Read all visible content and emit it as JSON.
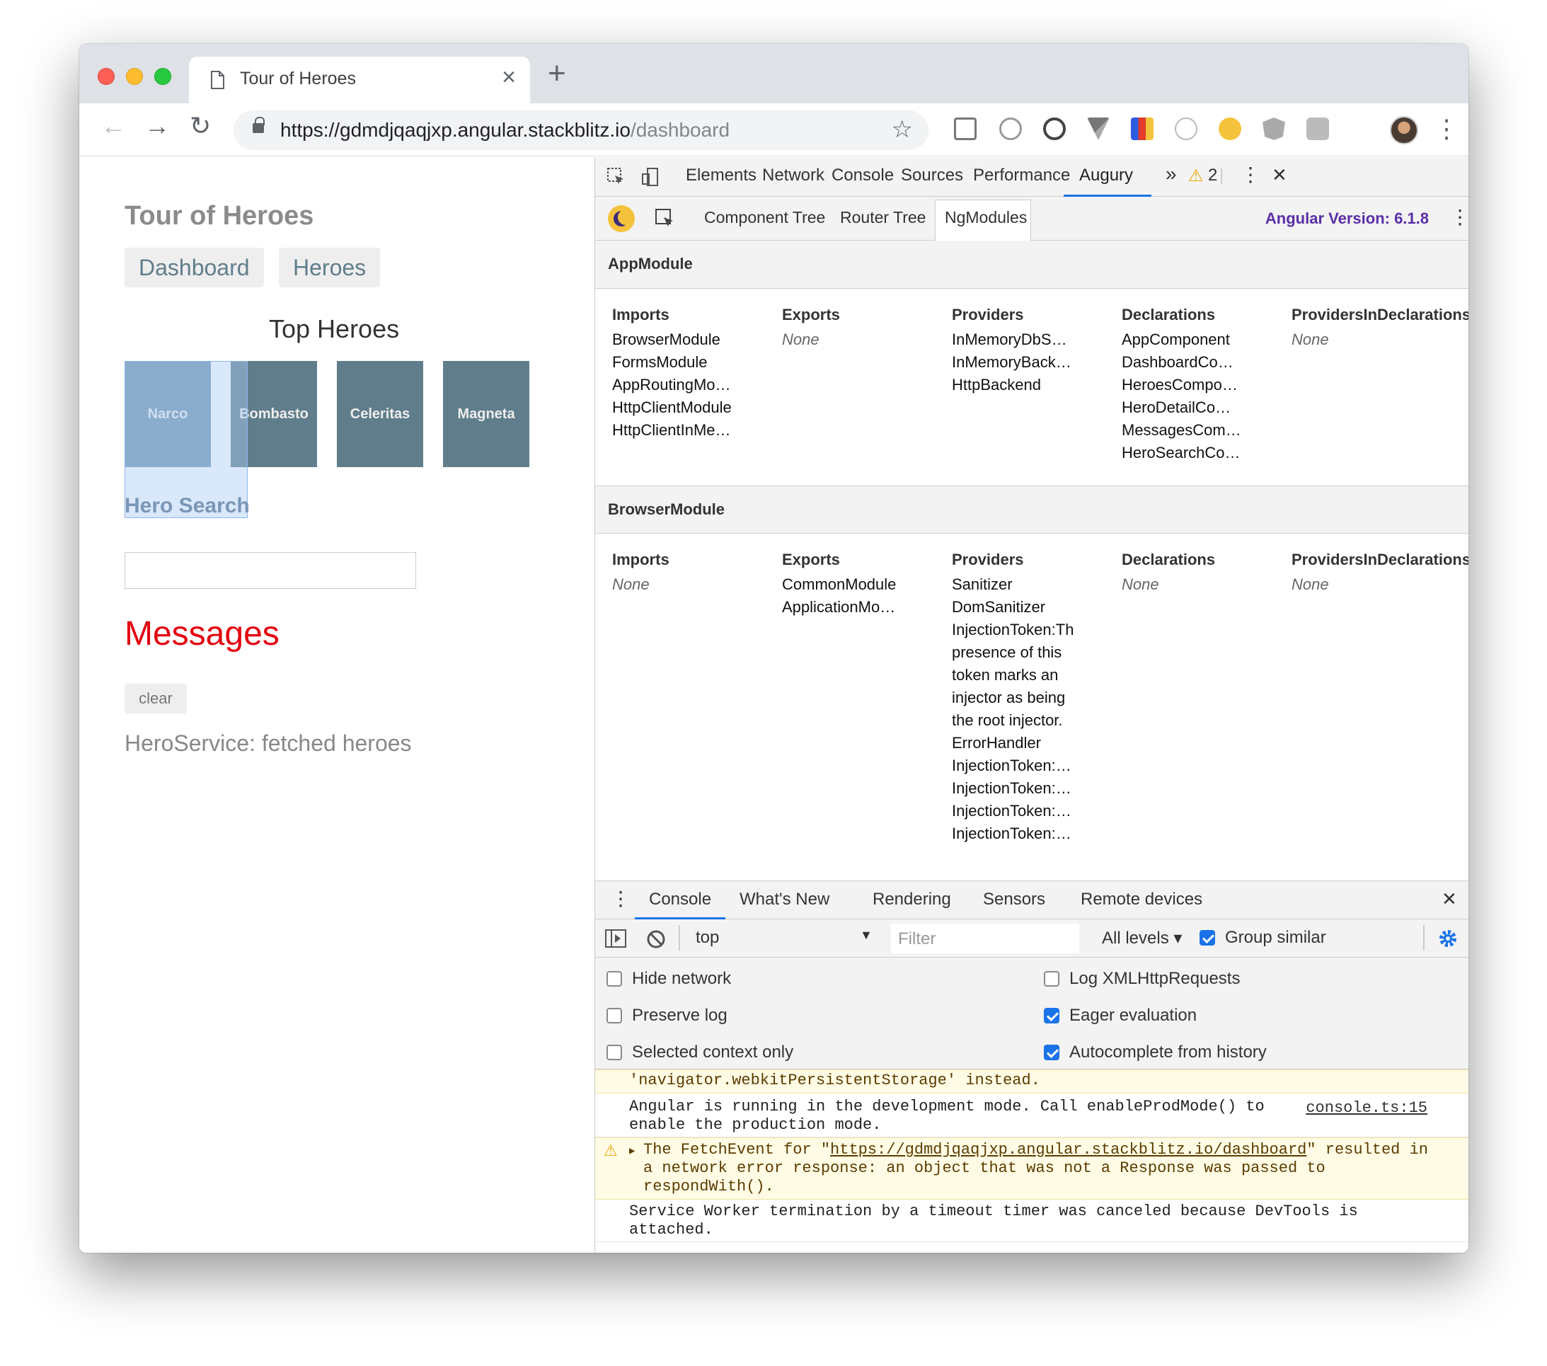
{
  "browser": {
    "tab_title": "Tour of Heroes",
    "tab_close": "×",
    "new_tab": "+",
    "url_host": "https://gdmdjqaqjxp.angular.stackblitz.io",
    "url_path": "/dashboard",
    "back": "←",
    "forward": "→",
    "reload": "↻",
    "star": "☆",
    "menu": "⋮"
  },
  "app": {
    "title": "Tour of Heroes",
    "nav": [
      "Dashboard",
      "Heroes"
    ],
    "top_heroes": "Top Heroes",
    "heroes": [
      "Narco",
      "Bombasto",
      "Celeritas",
      "Magneta"
    ],
    "hero_search": "Hero Search",
    "messages_title": "Messages",
    "clear_label": "clear",
    "message": "HeroService: fetched heroes"
  },
  "devtools": {
    "tabs": [
      "Elements",
      "Network",
      "Console",
      "Sources",
      "Performance",
      "Augury"
    ],
    "active_tab": "Augury",
    "more": "»",
    "warnings": "2",
    "menu": "⋮",
    "close": "✕",
    "augury": {
      "tabs": [
        "Component Tree",
        "Router Tree",
        "NgModules"
      ],
      "active": "NgModules",
      "version": "Angular Version: 6.1.8",
      "menu": "⋮"
    },
    "modules": [
      {
        "name": "AppModule",
        "headers": [
          "Imports",
          "Exports",
          "Providers",
          "Declarations",
          "ProvidersInDeclarations"
        ],
        "imports": [
          "BrowserModule",
          "FormsModule",
          "AppRoutingModule",
          "HttpClientModule",
          "HttpClientInMemory…"
        ],
        "exports": [
          "None"
        ],
        "providers": [
          "InMemoryDbService",
          "InMemoryBackendC…",
          "HttpBackend"
        ],
        "declarations": [
          "AppComponent",
          "DashboardCompon…",
          "HeroesComponent",
          "HeroDetailComponent",
          "MessagesComponent",
          "HeroSearchCompon…"
        ],
        "providers_in_declarations": [
          "None"
        ]
      },
      {
        "name": "BrowserModule",
        "headers": [
          "Imports",
          "Exports",
          "Providers",
          "Declarations",
          "ProvidersInDeclarations"
        ],
        "imports": [
          "None"
        ],
        "exports": [
          "CommonModule",
          "ApplicationModule"
        ],
        "providers_a": [
          "Sanitizer",
          "DomSanitizer"
        ],
        "providers_wrap": "InjectionToken:The presence of this token marks an injector as being the root injector.",
        "providers_b": [
          "ErrorHandler",
          "InjectionToken:Even…",
          "InjectionToken:Even…",
          "InjectionToken:Even…",
          "InjectionToken:Ham…"
        ],
        "declarations": [
          "None"
        ],
        "providers_in_declarations": [
          "None"
        ]
      }
    ],
    "drawer": {
      "tabs": [
        "Console",
        "What's New",
        "Rendering",
        "Sensors",
        "Remote devices"
      ],
      "active": "Console",
      "close": "✕",
      "context": "top",
      "filter_placeholder": "Filter",
      "levels": "All levels ▾",
      "group_similar": "Group similar",
      "settings": [
        {
          "label": "Hide network",
          "checked": false
        },
        {
          "label": "Log XMLHttpRequests",
          "checked": false
        },
        {
          "label": "Preserve log",
          "checked": false
        },
        {
          "label": "Eager evaluation",
          "checked": true
        },
        {
          "label": "Selected context only",
          "checked": false
        },
        {
          "label": "Autocomplete from history",
          "checked": true
        }
      ],
      "logs": {
        "l1": "'navigator.webkitPersistentStorage' instead.",
        "l2": "Angular is running in the development mode. Call enableProdMode() to\nenable the production mode.",
        "l2_src": "console.ts:15",
        "l3_pre": "The FetchEvent for \"",
        "l3_link": "https://gdmdjqaqjxp.angular.stackblitz.io/dashboard",
        "l3_post": "\" resulted in\na network error response: an object that was not a Response was passed to\nrespondWith().",
        "l4": "Service Worker termination by a timeout timer was canceled because DevTools is\nattached.",
        "prompt": "›"
      }
    }
  },
  "colors": {
    "hero_card": "#607d8b",
    "messages": "#e3000f",
    "accent": "#1a73e8",
    "augury_version": "#5a2ea6"
  }
}
